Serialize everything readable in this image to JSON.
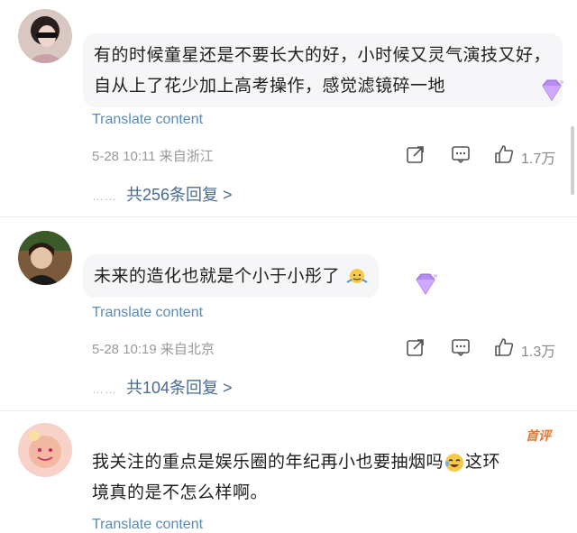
{
  "comments": [
    {
      "text": "有的时候童星还是不要长大的好，小时候又灵气演技又好，自从上了花少加上高考操作，感觉滤镜碎一地",
      "translate": "Translate content",
      "date": "5-28 10:11",
      "location": "来自浙江",
      "likes": "1.7万",
      "replies_label": "共256条回复 >",
      "dots": "……"
    },
    {
      "text": "未来的造化也就是个小于小彤了",
      "translate": "Translate content",
      "date": "5-28 10:19",
      "location": "来自北京",
      "likes": "1.3万",
      "replies_label": "共104条回复 >",
      "dots": "……"
    },
    {
      "text_line1": "我关注的重点是娱乐圈的年纪再小也要抽烟吗",
      "text_line2": "境真的是不怎么样啊。",
      "text_after_emoji": "这环",
      "badge": "首评",
      "translate": "Translate content"
    }
  ],
  "icons": [
    "share-icon",
    "comment-icon",
    "like-icon",
    "diamond-badge-icon"
  ],
  "colors": {
    "translate": "#5b8bb5",
    "replies": "#4a6b8f",
    "badge": "#e8742c",
    "bubble": "#f6f6f8"
  }
}
